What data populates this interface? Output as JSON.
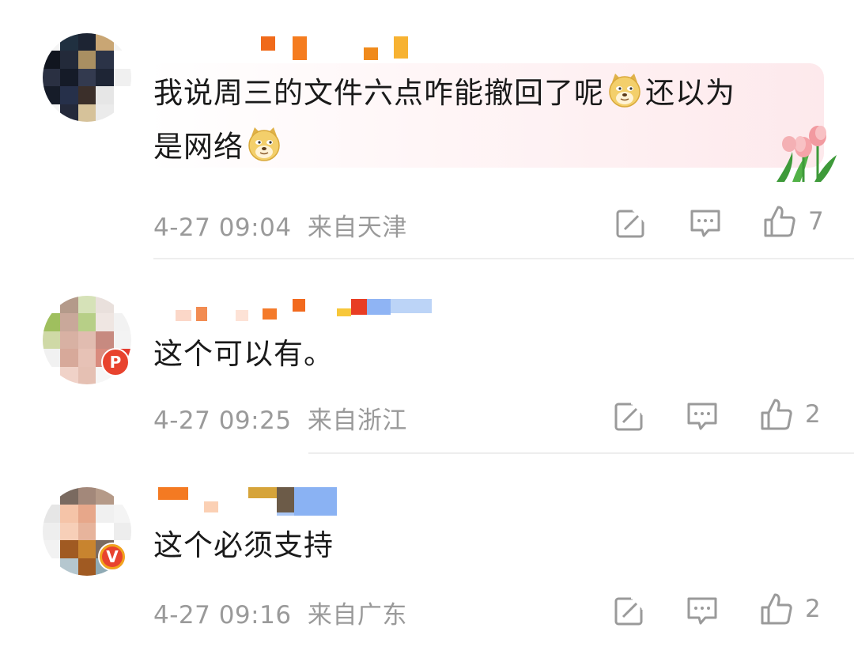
{
  "colors": {
    "meta_text": "#9a9a9a",
    "body_text": "#1a1a1a",
    "badge_red": "#e8432e",
    "badge_gold_border": "#f1a51c",
    "bubble_pink": "#fde9ec"
  },
  "comments": [
    {
      "text_line1": "我说周三的文件六点咋能撤回了呢",
      "text_mid": "还以为",
      "text_line2": "是网络",
      "emoji": "doge-emoji",
      "time": "4-27 09:04",
      "location": "来自天津",
      "like_count": "7",
      "avatar_colors": [
        "#f4f4f4",
        "#203040",
        "#1d2433",
        "#c9a674",
        "#f4f4f4",
        "#11151f",
        "#232a3a",
        "#a98f62",
        "#2b3347",
        "#ffffff",
        "#2a3042",
        "#151b28",
        "#333a4f",
        "#1e2535",
        "#f0f0f0",
        "#161c29",
        "#26304a",
        "#3b2f2a",
        "#e6e6e6",
        "#ffffff",
        "#f4f4f4",
        "#24293a",
        "#d6c29a",
        "#ebebeb",
        "#ffffff"
      ],
      "username_colors": [
        "#f06a1a",
        "#f57c1f",
        "#f08a1c",
        "#f7b232"
      ]
    },
    {
      "text": "这个可以有。",
      "time": "4-27 09:25",
      "location": "来自浙江",
      "like_count": "2",
      "avatar_colors": [
        "#ffffff",
        "#b49a8a",
        "#d6e2b8",
        "#e9e0dc",
        "#ffffff",
        "#9fbf5e",
        "#c9a89a",
        "#b7cf87",
        "#efe6e2",
        "#f2f2f2",
        "#cfd9a6",
        "#d8b1a3",
        "#e1bcb0",
        "#c78a80",
        "#f3f3f3",
        "#f1f1f1",
        "#d7a99a",
        "#e7c2b6",
        "#d98b7e",
        "#e33b2e",
        "#ffffff",
        "#f0d2c8",
        "#e5c0b3",
        "#f6f6f6",
        "#ffffff"
      ],
      "badge": "P",
      "username_colors": [
        "#fbd7c8",
        "#f28c52",
        "#fde2d6",
        "#f47a2a",
        "#f26a1e",
        "#f7c73a",
        "#e83d24",
        "#8fb4f4",
        "#bcd4f7"
      ]
    },
    {
      "text": "这个必须支持",
      "time": "4-27 09:16",
      "location": "来自广东",
      "like_count": "2",
      "avatar_colors": [
        "#ffffff",
        "#7a6a60",
        "#a3887a",
        "#b59a88",
        "#ffffff",
        "#e6e6e6",
        "#f5c4a8",
        "#e7a78a",
        "#f0f0f0",
        "#f4f4f4",
        "#eeeeee",
        "#f7cfb8",
        "#e7b49c",
        "#ffffff",
        "#ededed",
        "#f2f2f2",
        "#a05a22",
        "#c8842f",
        "#7a6a60",
        "#ffffff",
        "#ffffff",
        "#b5c7cf",
        "#a05a22",
        "#8faab5",
        "#ffffff"
      ],
      "badge": "V",
      "username_colors": [
        "#f47a22",
        "#fbd0b4",
        "#d6a43a",
        "#6c5b48",
        "#8ab2f3",
        "#a9c6f5"
      ]
    }
  ]
}
